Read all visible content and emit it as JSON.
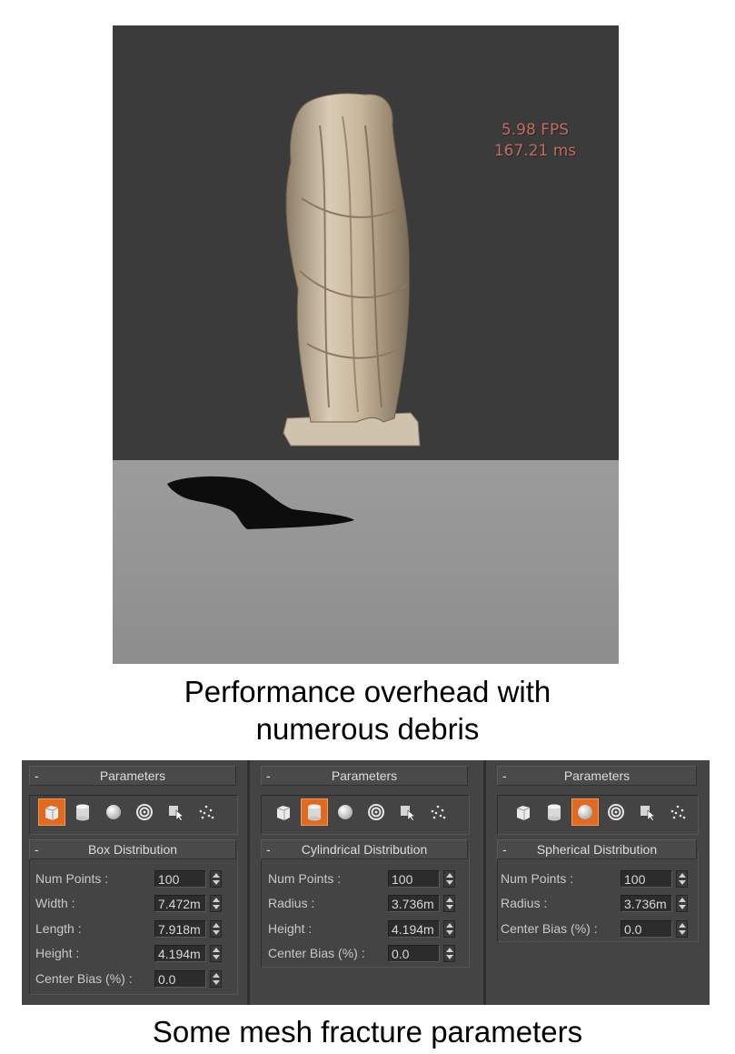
{
  "viewport": {
    "fps_label": "5.98 FPS",
    "ms_label": "167.21 ms",
    "colors": {
      "background": "#3b3b3b",
      "ground": "#959595",
      "fps_text": "#c26a5a"
    }
  },
  "captions": {
    "top_line1": "Performance overhead with",
    "top_line2": "numerous debris",
    "bottom": "Some mesh fracture parameters"
  },
  "panels": [
    {
      "header": "Parameters",
      "selected_icon": "box-icon",
      "section": "Box Distribution",
      "rows": [
        {
          "label": "Num Points :",
          "value": "100"
        },
        {
          "label": "Width :",
          "value": "7.472m"
        },
        {
          "label": "Length :",
          "value": "7.918m"
        },
        {
          "label": "Height :",
          "value": "4.194m"
        },
        {
          "label": "Center Bias (%) :",
          "value": "0.0"
        }
      ]
    },
    {
      "header": "Parameters",
      "selected_icon": "cylinder-icon",
      "section": "Cylindrical Distribution",
      "rows": [
        {
          "label": "Num Points :",
          "value": "100"
        },
        {
          "label": "Radius :",
          "value": "3.736m"
        },
        {
          "label": "Height :",
          "value": "4.194m"
        },
        {
          "label": "Center Bias (%) :",
          "value": "0.0"
        }
      ]
    },
    {
      "header": "Parameters",
      "selected_icon": "sphere-icon",
      "section": "Spherical Distribution",
      "rows": [
        {
          "label": "Num Points :",
          "value": "100"
        },
        {
          "label": "Radius :",
          "value": "3.736m"
        },
        {
          "label": "Center Bias (%) :",
          "value": "0.0"
        }
      ]
    }
  ],
  "icons": [
    "box-icon",
    "cylinder-icon",
    "sphere-icon",
    "target-icon",
    "cursor-select-icon",
    "scatter-points-icon"
  ],
  "accent_color": "#e06a1f"
}
